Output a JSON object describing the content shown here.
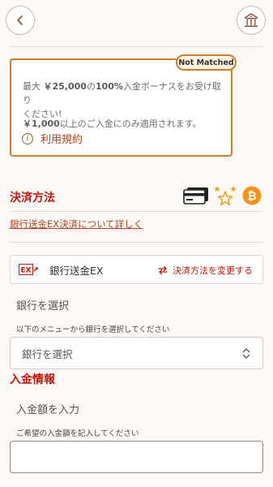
{
  "header": {
    "back_icon": "chevron-left-icon",
    "home_icon": "casino-building-icon"
  },
  "bonus": {
    "status_badge": "Not Matched",
    "line1_prefix": "最大 ",
    "line1_amount": "￥25,000",
    "line1_mid": "の",
    "line1_percent": "100%",
    "line1_suffix": "入金ボーナスをお受け取り",
    "line2": "ください!",
    "min_amount": "￥1,000",
    "min_suffix": "以上のご入金にのみ適用されます。",
    "terms_label": "利用規約"
  },
  "payment": {
    "section_title": "決済方法",
    "icons": [
      "credit-card-icon",
      "stars-icon",
      "bitcoin-icon"
    ],
    "detail_link": "銀行送金EX決済について詳しく",
    "method_logo": "EX",
    "method_name": "銀行送金EX",
    "change_label": "決済方法を変更する"
  },
  "bank": {
    "title": "銀行を選択",
    "hint": "以下のメニューから銀行を選択してください",
    "select_value": "銀行を選択"
  },
  "deposit": {
    "section_title": "入金情報",
    "title": "入金額を入力",
    "hint": "ご希望の入金額を記入してください",
    "input_value": ""
  },
  "colors": {
    "accent_red": "#c0140c",
    "box_border": "#d07c2c",
    "bitcoin": "#f7931a",
    "star_gold": "#e6a21c"
  }
}
